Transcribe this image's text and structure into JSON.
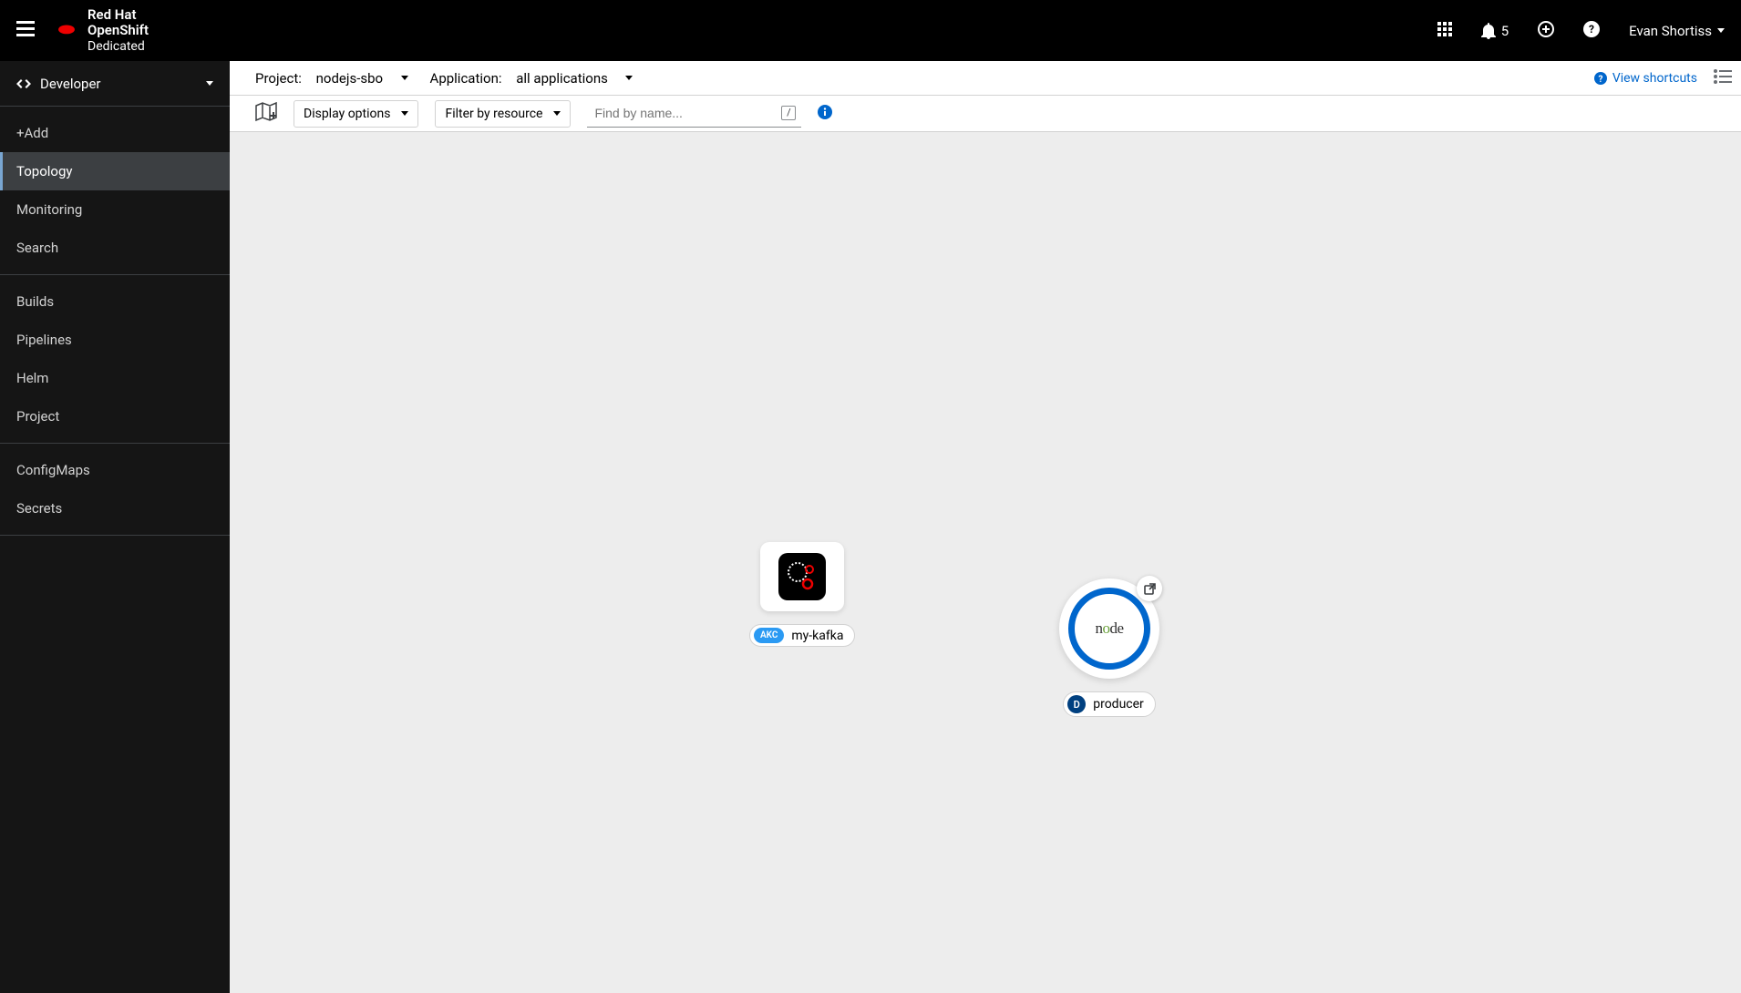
{
  "brand": {
    "line1": "Red Hat",
    "line2": "OpenShift",
    "line3": "Dedicated"
  },
  "notifications": {
    "count": "5"
  },
  "user": {
    "name": "Evan Shortiss"
  },
  "perspective": {
    "label": "Developer"
  },
  "nav": {
    "g1": [
      "+Add",
      "Topology",
      "Monitoring",
      "Search"
    ],
    "g2": [
      "Builds",
      "Pipelines",
      "Helm",
      "Project"
    ],
    "g3": [
      "ConfigMaps",
      "Secrets"
    ],
    "active": "Topology"
  },
  "toolbar": {
    "project_label": "Project:",
    "project_value": "nodejs-sbo",
    "app_label": "Application:",
    "app_value": "all applications",
    "shortcuts": "View shortcuts",
    "display_options": "Display options",
    "filter": "Filter by resource",
    "search_placeholder": "Find by name...",
    "search_key": "/"
  },
  "topology": {
    "kafka": {
      "badge": "AKC",
      "name": "my-kafka"
    },
    "producer": {
      "badge": "D",
      "name": "producer",
      "runtime": "node"
    }
  }
}
